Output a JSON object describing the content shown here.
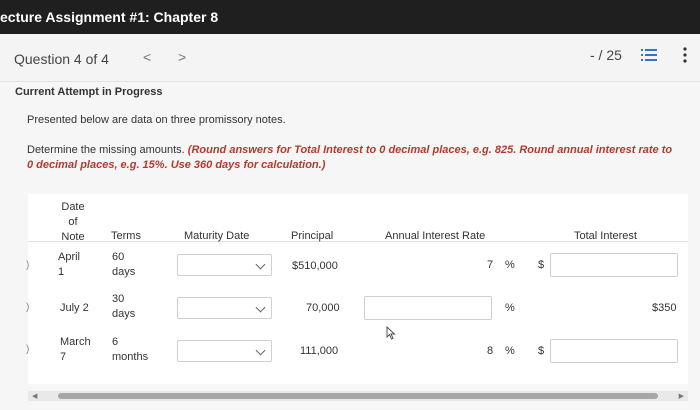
{
  "header": {
    "title": "ecture Assignment #1: Chapter 8"
  },
  "question_bar": {
    "label": "Question 4 of 4",
    "prev": "<",
    "next": ">",
    "score": "- / 25"
  },
  "attempt_label": "Current Attempt in Progress",
  "intro": "Presented below are data on three promissory notes.",
  "instructions": {
    "plain": "Determine the missing amounts.",
    "emphasis": "(Round answers for Total Interest to 0 decimal places, e.g. 825. Round annual interest rate to 0 decimal places, e.g. 15%. Use 360 days for calculation.)"
  },
  "table": {
    "headers": {
      "date_l1": "Date",
      "date_l2": "of",
      "date_l3": "Note",
      "terms": "Terms",
      "maturity": "Maturity Date",
      "principal": "Principal",
      "rate": "Annual Interest Rate",
      "interest": "Total Interest"
    },
    "rows": [
      {
        "marker": ")",
        "date_l1": "April",
        "date_l2": "1",
        "terms_l1": "60",
        "terms_l2": "days",
        "principal": "$510,000",
        "rate": "7",
        "pct": "%",
        "dollar": "$",
        "interest": ""
      },
      {
        "marker": ")",
        "date_l1": "July 2",
        "date_l2": "",
        "terms_l1": "30",
        "terms_l2": "days",
        "principal": "70,000",
        "rate": "",
        "pct": "%",
        "dollar": "",
        "interest": "$350"
      },
      {
        "marker": ")",
        "date_l1": "March",
        "date_l2": "7",
        "terms_l1": "6",
        "terms_l2": "months",
        "principal": "111,000",
        "rate": "8",
        "pct": "%",
        "dollar": "$",
        "interest": ""
      }
    ]
  },
  "icons": {
    "list": "list-icon",
    "more": "more-vertical-icon",
    "cursor": "mouse-cursor-icon"
  }
}
